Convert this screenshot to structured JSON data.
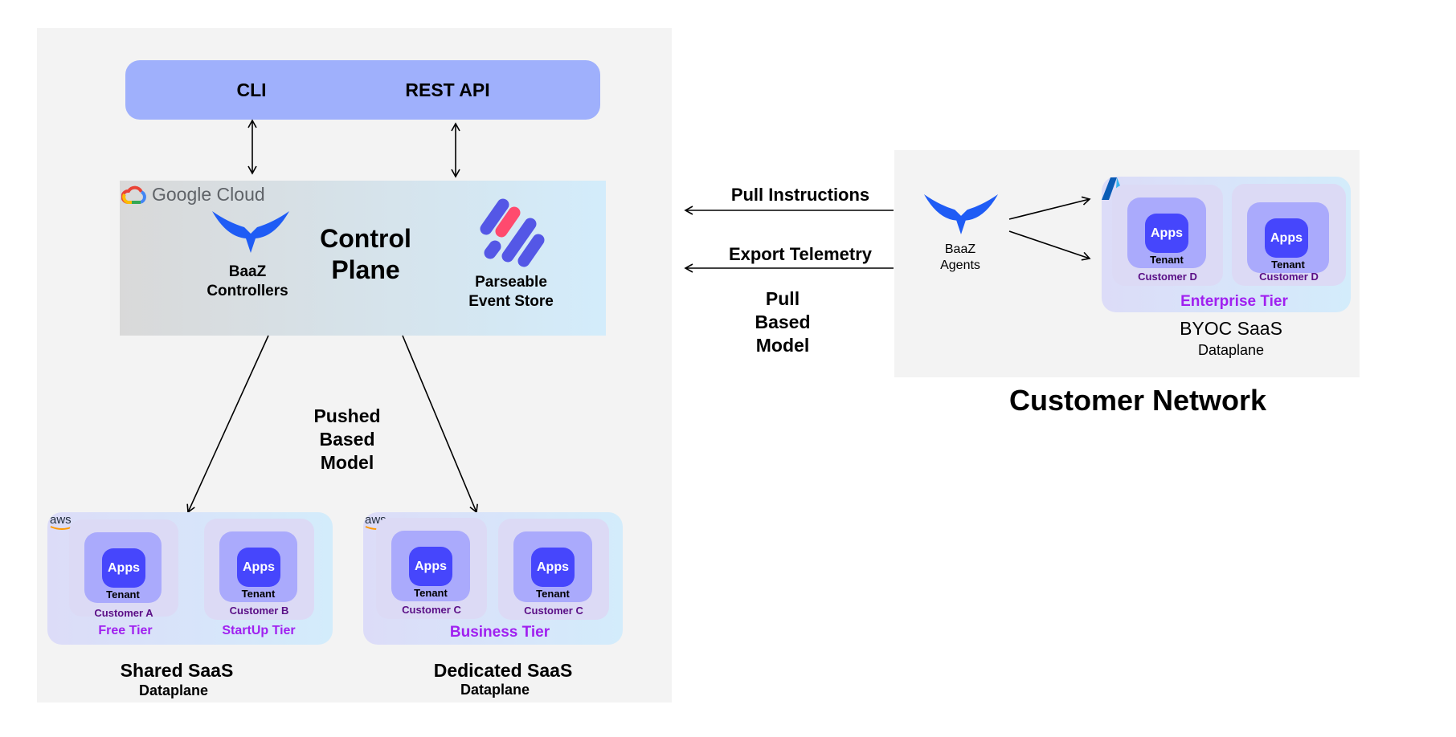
{
  "api": {
    "cli": "CLI",
    "rest": "REST API"
  },
  "control_plane": {
    "cloud_logo": "Google Cloud",
    "controllers": [
      "BaaZ",
      "Controllers"
    ],
    "title": [
      "Control",
      "Plane"
    ],
    "event_store": [
      "Parseable",
      "Event Store"
    ]
  },
  "pushed_model": [
    "Pushed",
    "Based",
    "Model"
  ],
  "pull_model": [
    "Pull",
    "Based",
    "Model"
  ],
  "arrows": {
    "pull": "Pull Instructions",
    "export": "Export Telemetry"
  },
  "shared": {
    "provider": "aws",
    "cards": [
      {
        "apps": "Apps",
        "tenant": "Tenant",
        "customer": "Customer A",
        "tier": "Free Tier"
      },
      {
        "apps": "Apps",
        "tenant": "Tenant",
        "customer": "Customer B",
        "tier": "StartUp Tier"
      }
    ],
    "title": "Shared SaaS",
    "subtitle": "Dataplane"
  },
  "dedicated": {
    "provider": "aws",
    "cards": [
      {
        "apps": "Apps",
        "tenant": "Tenant",
        "customer": "Customer C"
      },
      {
        "apps": "Apps",
        "tenant": "Tenant",
        "customer": "Customer C"
      }
    ],
    "tier": "Business Tier",
    "title": "Dedicated SaaS",
    "subtitle": "Dataplane"
  },
  "byoc": {
    "agents": [
      "BaaZ",
      "Agents"
    ],
    "cards": [
      {
        "apps": "Apps",
        "tenant": "Tenant",
        "customer": "Customer D"
      },
      {
        "apps": "Apps",
        "tenant": "Tenant",
        "customer": "Customer D"
      }
    ],
    "tier": "Enterprise Tier",
    "title": "BYOC SaaS",
    "subtitle": "Dataplane"
  },
  "customer_network": "Customer Network",
  "colors": {
    "api": "#9fb0fc",
    "apps": "#4646fc",
    "tenant": "#aaaafc",
    "card": "#dcdaf5",
    "tier": "#a020f0",
    "customer": "#5a0f86",
    "baaz_blue": "#1f5cf5",
    "parseable_red": "#ff4a6e",
    "parseable_purple": "#5457e6"
  }
}
